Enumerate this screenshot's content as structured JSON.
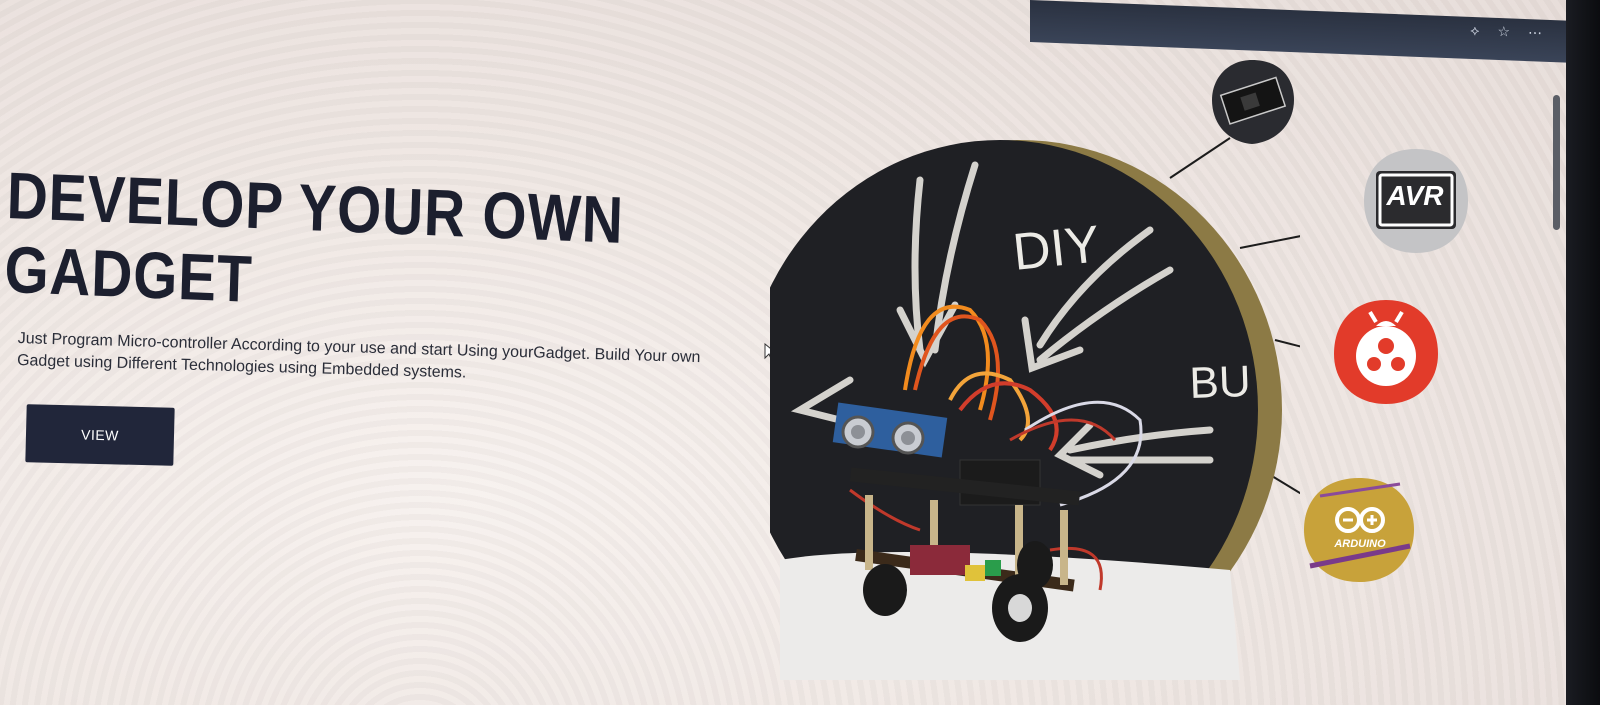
{
  "hero": {
    "title": "DEVELOP YOUR OWN GADGET",
    "description": "Just Program Micro-controller According to your use and start Using yourGadget. Build Your own Gadget using Different Technologies using Embedded systems.",
    "cta_label": "VIEW"
  },
  "illustration": {
    "chalk_text_1": "DIY",
    "chalk_text_2": "BU"
  },
  "technologies": {
    "avr_label": "AVR",
    "arduino_label": "ARDUINO"
  },
  "colors": {
    "title": "#1c1f2e",
    "button_bg": "#21263a",
    "circle_dark": "#1f2024",
    "gold_rim": "#8c7a45",
    "avr_bg": "#2b2b2e",
    "bug_red": "#e23b2a",
    "arduino_gold": "#c8a23a"
  },
  "icons": [
    "cursor-icon",
    "nano-board-icon",
    "avr-chip-icon",
    "ladybug-logo-icon",
    "arduino-board-icon"
  ]
}
